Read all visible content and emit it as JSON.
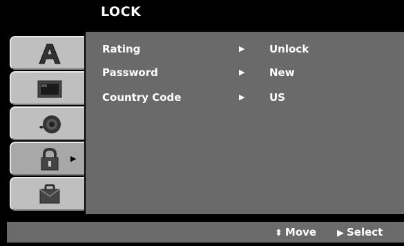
{
  "header": {
    "title": "LOCK"
  },
  "menu": [
    {
      "label": "Rating",
      "value": "Unlock"
    },
    {
      "label": "Password",
      "value": "New"
    },
    {
      "label": "Country Code",
      "value": "US"
    }
  ],
  "sidebar": {
    "tabs": [
      {
        "icon": "letter-a-icon",
        "active": false
      },
      {
        "icon": "tv-screen-icon",
        "active": false
      },
      {
        "icon": "speaker-icon",
        "active": false
      },
      {
        "icon": "padlock-icon",
        "active": true
      },
      {
        "icon": "briefcase-icon",
        "active": false
      }
    ]
  },
  "footer": {
    "move_label": "Move",
    "select_label": "Select"
  },
  "colors": {
    "panel": "#6a6a6a",
    "tab": "#bfbfbf",
    "background": "#000000"
  }
}
